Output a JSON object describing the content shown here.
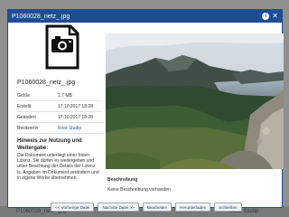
{
  "window": {
    "title": "P1060028_netz_.jpg"
  },
  "file": {
    "name": "P1060028_netz_.jpg",
    "icon": "image-file-icon"
  },
  "meta": [
    {
      "key": "Größe",
      "value": "1,7 MB"
    },
    {
      "key": "Erstellt",
      "value": "17.10.2017 18:28"
    },
    {
      "key": "Geändert",
      "value": "17.10.2017 18:28"
    },
    {
      "key": "Besitzer/in",
      "value": "Root Studip"
    }
  ],
  "notice": {
    "title": "Hinweis zur Nutzung und Weitergabe:",
    "text": "Die Dokument unterliegt einer freien Lizenz. Sie dürfen es weitergeben und unter Beachtung der Details der Lizenz ls. Angaben im Dokument verändern und in eigene Werke übernehmen."
  },
  "description": {
    "label": "Beschreibung",
    "text": "Keine Beschreibung vorhanden"
  },
  "buttons": {
    "prev": "<< Vorherige Datei",
    "next": "Nächste Datei >>",
    "edit": "Bearbeiten",
    "download": "Herunterladen",
    "close": "Schließen"
  },
  "background": {
    "bottom_left": "P1060028_netz_.jpg",
    "bottom_right": "Root Studip"
  },
  "colors": {
    "titlebar": "#1e4d93",
    "link": "#2b5aa8"
  }
}
